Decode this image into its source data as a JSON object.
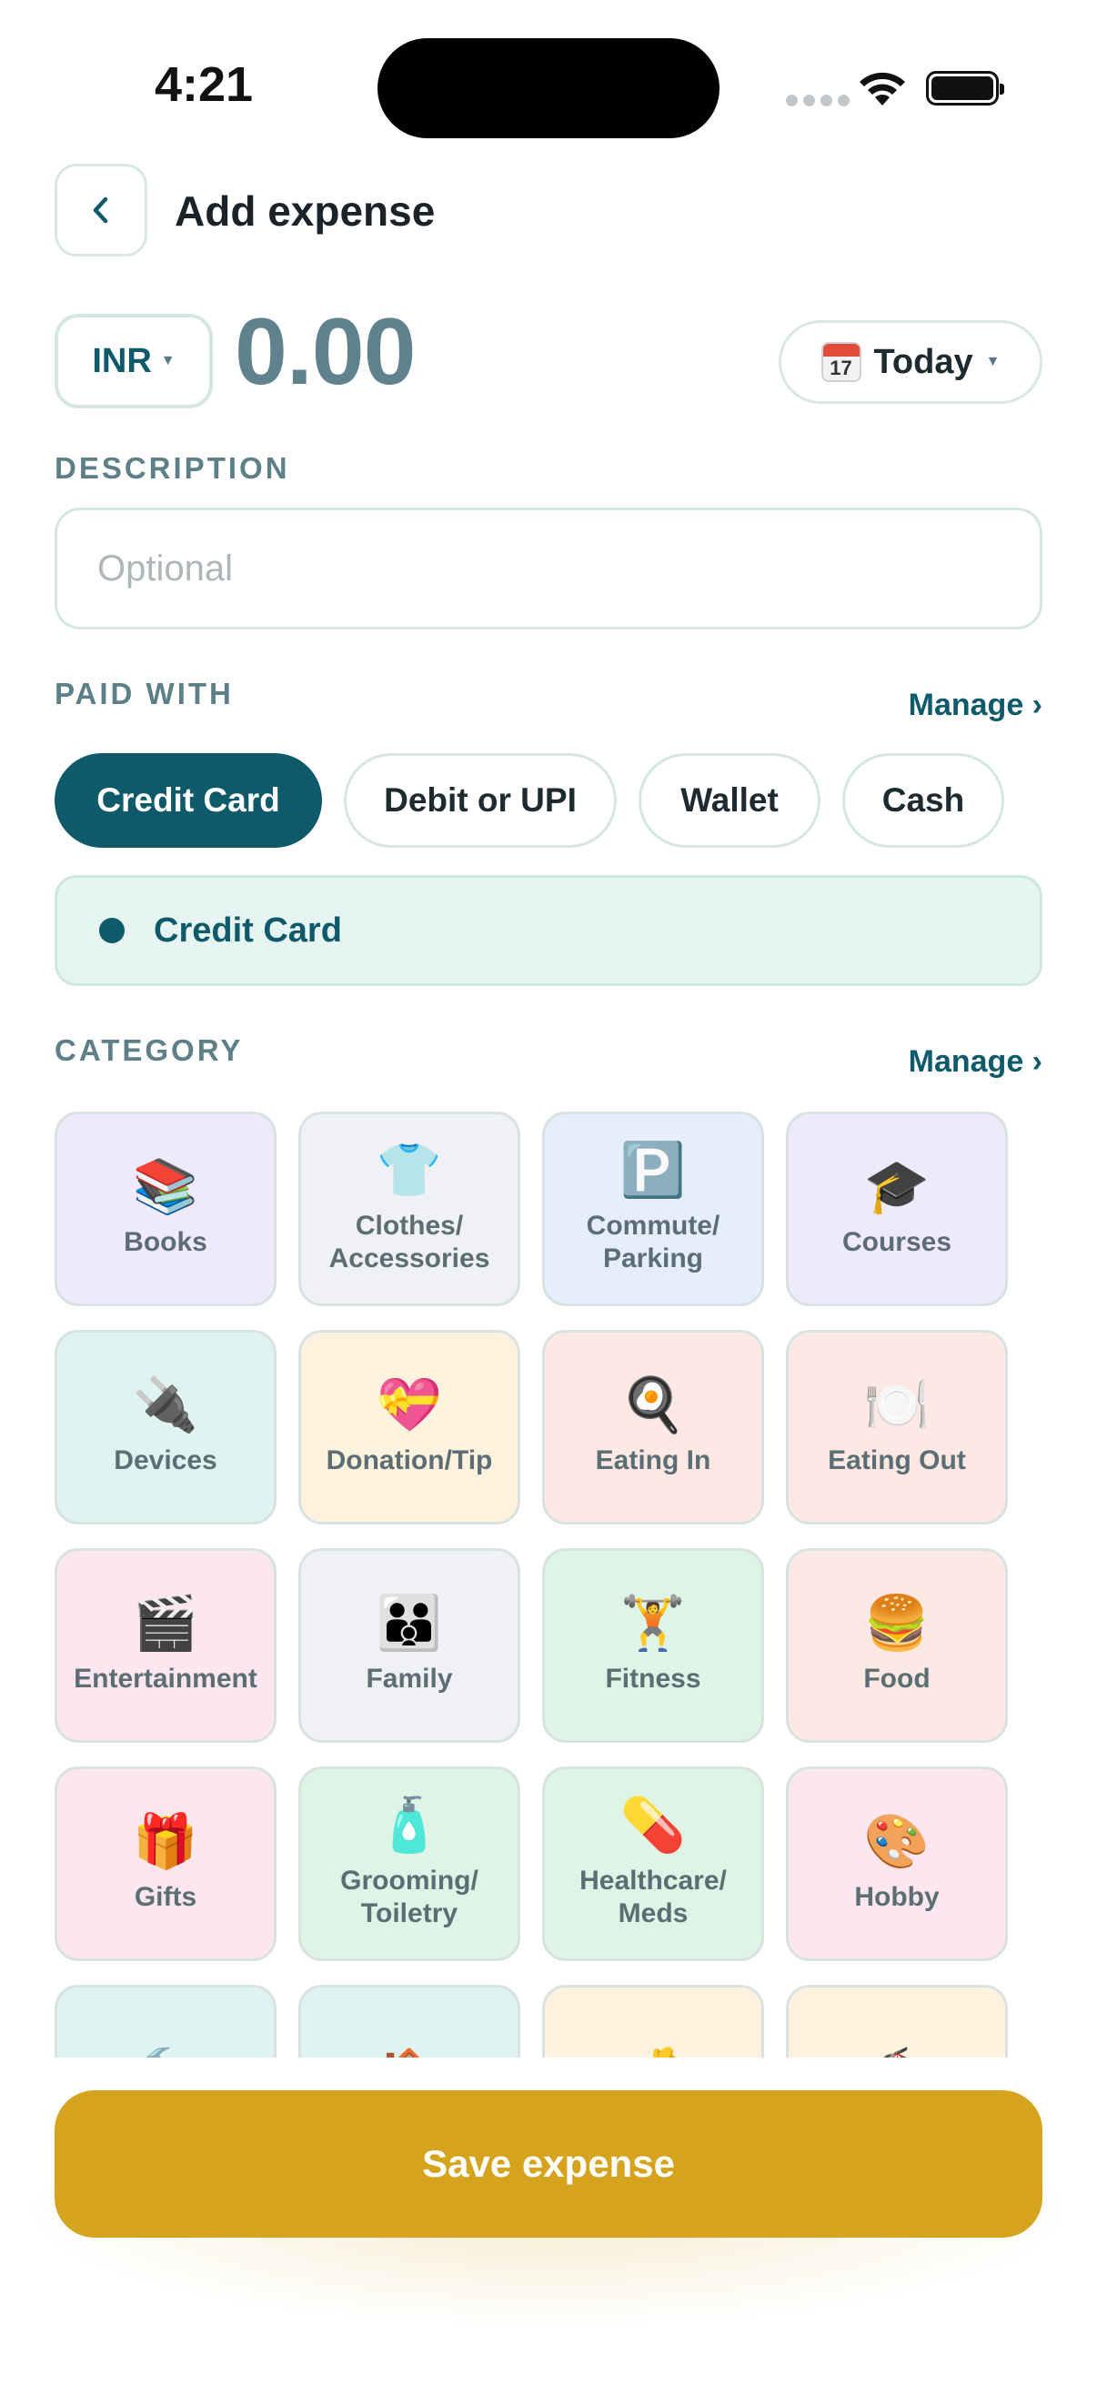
{
  "status_bar": {
    "time": "4:21"
  },
  "header": {
    "title": "Add expense",
    "back_icon": "chevron-left-icon"
  },
  "amount": {
    "currency": "INR",
    "value": "0.00"
  },
  "date": {
    "label": "Today",
    "calendar_day": "17",
    "icon": "calendar-icon"
  },
  "description": {
    "label": "DESCRIPTION",
    "placeholder": "Optional",
    "value": ""
  },
  "paid_with": {
    "label": "PAID WITH",
    "manage": "Manage ›",
    "methods": [
      "Credit Card",
      "Debit or UPI",
      "Wallet",
      "Cash"
    ],
    "selected": "Credit Card"
  },
  "category": {
    "label": "CATEGORY",
    "manage": "Manage ›",
    "items": [
      {
        "name": "Books",
        "emoji": "📚",
        "color": "#efe9fc"
      },
      {
        "name": "Clothes/\nAccessories",
        "emoji": "👕",
        "color": "#eff1f4"
      },
      {
        "name": "Commute/\nParking",
        "emoji": "🅿️",
        "color": "#e6eefc"
      },
      {
        "name": "Courses",
        "emoji": "🎓",
        "color": "#efe9fc"
      },
      {
        "name": "Devices",
        "emoji": "🔌",
        "color": "#dff4f1"
      },
      {
        "name": "Donation/Tip",
        "emoji": "💝",
        "color": "#fdf2de"
      },
      {
        "name": "Eating In",
        "emoji": "🍳",
        "color": "#fde9e4"
      },
      {
        "name": "Eating Out",
        "emoji": "🍽️",
        "color": "#fde9e4"
      },
      {
        "name": "Entertainment",
        "emoji": "🎬",
        "color": "#fce6f0"
      },
      {
        "name": "Family",
        "emoji": "👪",
        "color": "#eff1f4"
      },
      {
        "name": "Fitness",
        "emoji": "🏋️",
        "color": "#def4e6"
      },
      {
        "name": "Food",
        "emoji": "🍔",
        "color": "#fde9e4"
      },
      {
        "name": "Gifts",
        "emoji": "🎁",
        "color": "#fce6f0"
      },
      {
        "name": "Grooming/\nToiletry",
        "emoji": "🧴",
        "color": "#def4e6"
      },
      {
        "name": "Healthcare/\nMeds",
        "emoji": "💊",
        "color": "#def4e6"
      },
      {
        "name": "Hobby",
        "emoji": "🎨",
        "color": "#fce6f0"
      },
      {
        "name": "",
        "emoji": "🔨",
        "color": "#dff4f1"
      },
      {
        "name": "",
        "emoji": "🏠",
        "color": "#dff4f1"
      },
      {
        "name": "",
        "emoji": "💰",
        "color": "#fdf2de"
      },
      {
        "name": "",
        "emoji": "🧯",
        "color": "#fdf2de"
      }
    ]
  },
  "save": {
    "label": "Save expense",
    "color": "#d6a31e"
  }
}
